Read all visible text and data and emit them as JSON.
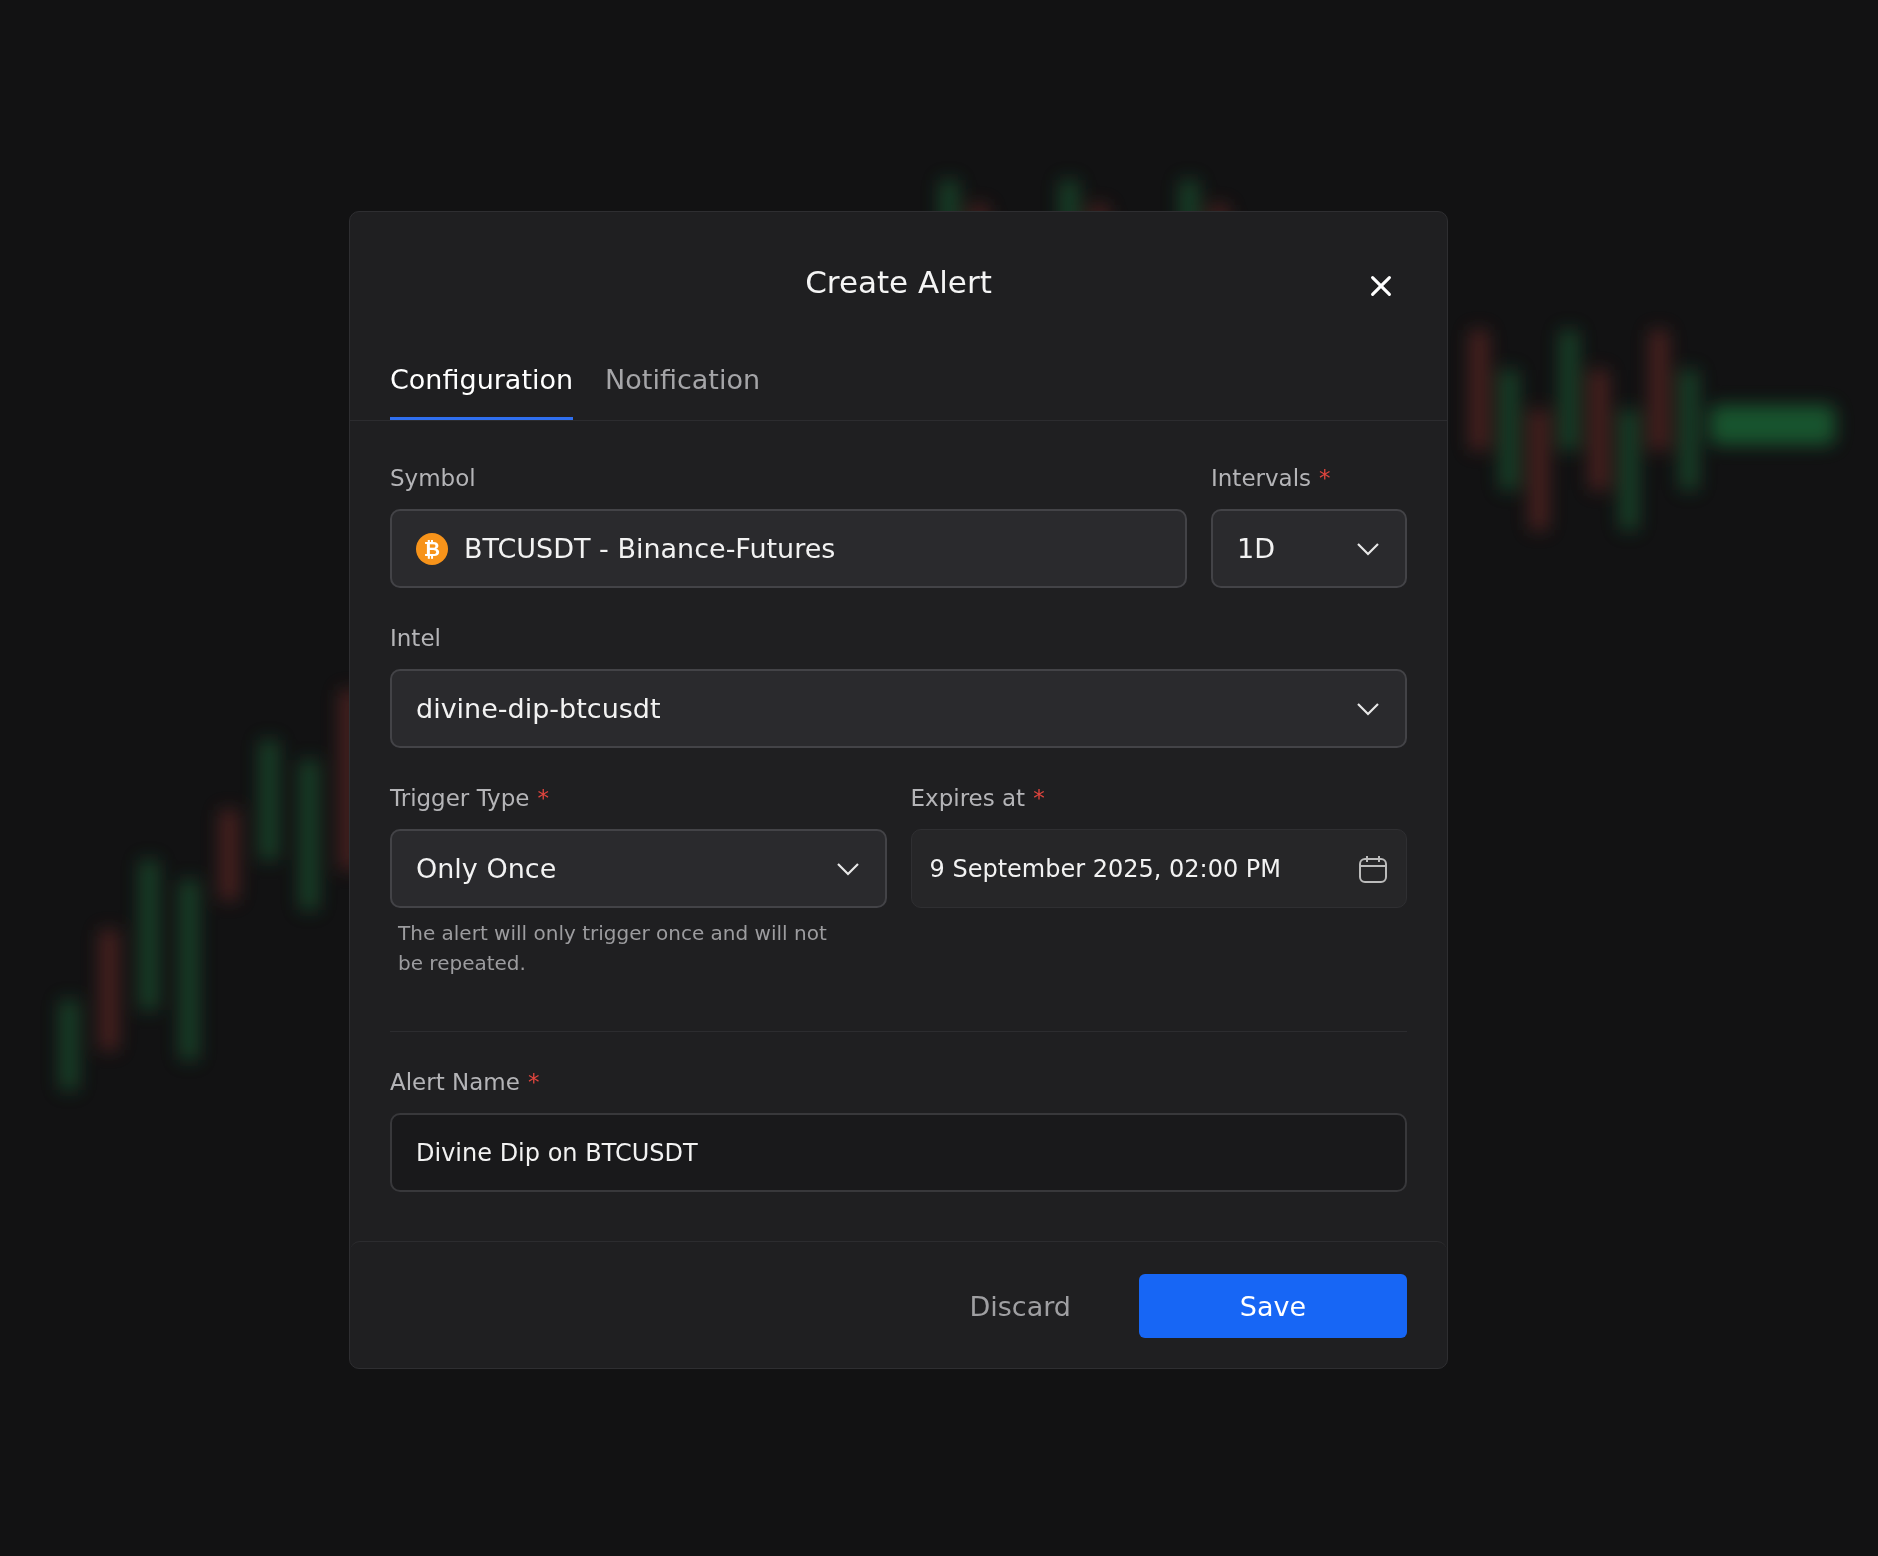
{
  "dialog": {
    "title": "Create Alert",
    "tabs": [
      {
        "label": "Configuration",
        "selected": true
      },
      {
        "label": "Notification",
        "selected": false
      }
    ],
    "symbol": {
      "label": "Symbol",
      "required": false,
      "value": "BTCUSDT - Binance-Futures",
      "coin_glyph": "₿"
    },
    "intervals": {
      "label": "Intervals",
      "required": true,
      "value": "1D"
    },
    "intel": {
      "label": "Intel",
      "required": false,
      "value": "divine-dip-btcusdt"
    },
    "trigger_type": {
      "label": "Trigger Type",
      "required": true,
      "value": "Only Once",
      "help": "The alert will only trigger once and will not be repeated."
    },
    "expires_at": {
      "label": "Expires at",
      "required": true,
      "value": "9 September 2025, 02:00 PM"
    },
    "alert_name": {
      "label": "Alert Name",
      "required": true,
      "value": "Divine Dip on BTCUSDT"
    },
    "buttons": [
      {
        "label": "Discard",
        "kind": "secondary"
      },
      {
        "label": "Save",
        "kind": "primary"
      }
    ],
    "required_mark": "*"
  }
}
